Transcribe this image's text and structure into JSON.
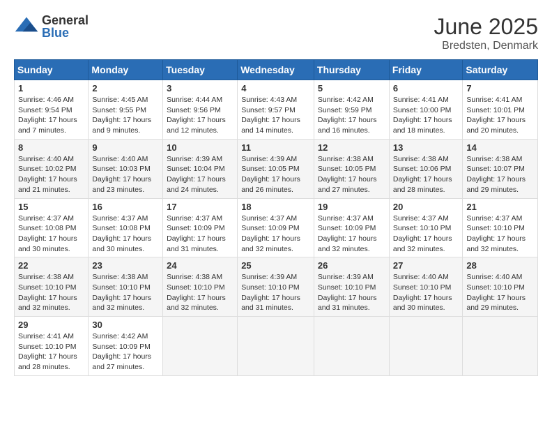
{
  "header": {
    "logo_general": "General",
    "logo_blue": "Blue",
    "month_title": "June 2025",
    "subtitle": "Bredsten, Denmark"
  },
  "days_of_week": [
    "Sunday",
    "Monday",
    "Tuesday",
    "Wednesday",
    "Thursday",
    "Friday",
    "Saturday"
  ],
  "weeks": [
    [
      {
        "day": "1",
        "sunrise": "4:46 AM",
        "sunset": "9:54 PM",
        "daylight": "17 hours and 7 minutes."
      },
      {
        "day": "2",
        "sunrise": "4:45 AM",
        "sunset": "9:55 PM",
        "daylight": "17 hours and 9 minutes."
      },
      {
        "day": "3",
        "sunrise": "4:44 AM",
        "sunset": "9:56 PM",
        "daylight": "17 hours and 12 minutes."
      },
      {
        "day": "4",
        "sunrise": "4:43 AM",
        "sunset": "9:57 PM",
        "daylight": "17 hours and 14 minutes."
      },
      {
        "day": "5",
        "sunrise": "4:42 AM",
        "sunset": "9:59 PM",
        "daylight": "17 hours and 16 minutes."
      },
      {
        "day": "6",
        "sunrise": "4:41 AM",
        "sunset": "10:00 PM",
        "daylight": "17 hours and 18 minutes."
      },
      {
        "day": "7",
        "sunrise": "4:41 AM",
        "sunset": "10:01 PM",
        "daylight": "17 hours and 20 minutes."
      }
    ],
    [
      {
        "day": "8",
        "sunrise": "4:40 AM",
        "sunset": "10:02 PM",
        "daylight": "17 hours and 21 minutes."
      },
      {
        "day": "9",
        "sunrise": "4:40 AM",
        "sunset": "10:03 PM",
        "daylight": "17 hours and 23 minutes."
      },
      {
        "day": "10",
        "sunrise": "4:39 AM",
        "sunset": "10:04 PM",
        "daylight": "17 hours and 24 minutes."
      },
      {
        "day": "11",
        "sunrise": "4:39 AM",
        "sunset": "10:05 PM",
        "daylight": "17 hours and 26 minutes."
      },
      {
        "day": "12",
        "sunrise": "4:38 AM",
        "sunset": "10:05 PM",
        "daylight": "17 hours and 27 minutes."
      },
      {
        "day": "13",
        "sunrise": "4:38 AM",
        "sunset": "10:06 PM",
        "daylight": "17 hours and 28 minutes."
      },
      {
        "day": "14",
        "sunrise": "4:38 AM",
        "sunset": "10:07 PM",
        "daylight": "17 hours and 29 minutes."
      }
    ],
    [
      {
        "day": "15",
        "sunrise": "4:37 AM",
        "sunset": "10:08 PM",
        "daylight": "17 hours and 30 minutes."
      },
      {
        "day": "16",
        "sunrise": "4:37 AM",
        "sunset": "10:08 PM",
        "daylight": "17 hours and 30 minutes."
      },
      {
        "day": "17",
        "sunrise": "4:37 AM",
        "sunset": "10:09 PM",
        "daylight": "17 hours and 31 minutes."
      },
      {
        "day": "18",
        "sunrise": "4:37 AM",
        "sunset": "10:09 PM",
        "daylight": "17 hours and 32 minutes."
      },
      {
        "day": "19",
        "sunrise": "4:37 AM",
        "sunset": "10:09 PM",
        "daylight": "17 hours and 32 minutes."
      },
      {
        "day": "20",
        "sunrise": "4:37 AM",
        "sunset": "10:10 PM",
        "daylight": "17 hours and 32 minutes."
      },
      {
        "day": "21",
        "sunrise": "4:37 AM",
        "sunset": "10:10 PM",
        "daylight": "17 hours and 32 minutes."
      }
    ],
    [
      {
        "day": "22",
        "sunrise": "4:38 AM",
        "sunset": "10:10 PM",
        "daylight": "17 hours and 32 minutes."
      },
      {
        "day": "23",
        "sunrise": "4:38 AM",
        "sunset": "10:10 PM",
        "daylight": "17 hours and 32 minutes."
      },
      {
        "day": "24",
        "sunrise": "4:38 AM",
        "sunset": "10:10 PM",
        "daylight": "17 hours and 32 minutes."
      },
      {
        "day": "25",
        "sunrise": "4:39 AM",
        "sunset": "10:10 PM",
        "daylight": "17 hours and 31 minutes."
      },
      {
        "day": "26",
        "sunrise": "4:39 AM",
        "sunset": "10:10 PM",
        "daylight": "17 hours and 31 minutes."
      },
      {
        "day": "27",
        "sunrise": "4:40 AM",
        "sunset": "10:10 PM",
        "daylight": "17 hours and 30 minutes."
      },
      {
        "day": "28",
        "sunrise": "4:40 AM",
        "sunset": "10:10 PM",
        "daylight": "17 hours and 29 minutes."
      }
    ],
    [
      {
        "day": "29",
        "sunrise": "4:41 AM",
        "sunset": "10:10 PM",
        "daylight": "17 hours and 28 minutes."
      },
      {
        "day": "30",
        "sunrise": "4:42 AM",
        "sunset": "10:09 PM",
        "daylight": "17 hours and 27 minutes."
      },
      null,
      null,
      null,
      null,
      null
    ]
  ]
}
